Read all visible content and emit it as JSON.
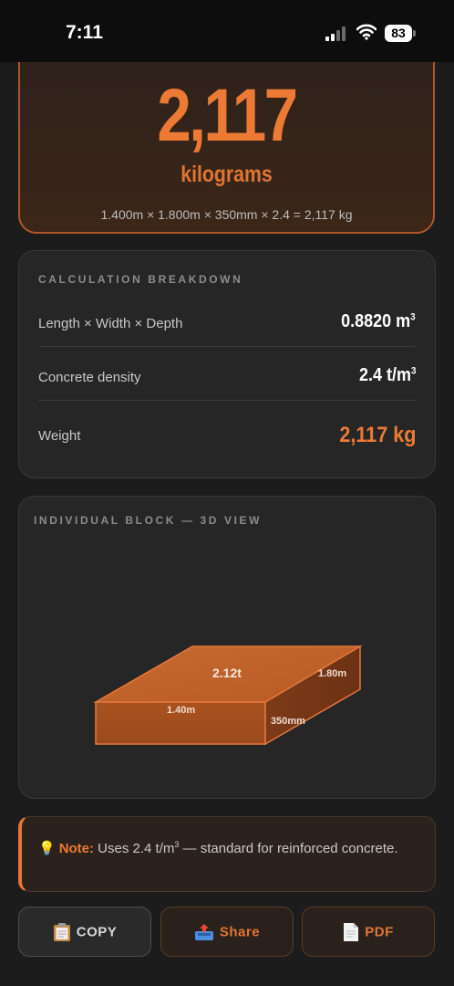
{
  "status": {
    "time": "7:11",
    "battery": "83",
    "icons": [
      "signal-icon",
      "wifi-icon",
      "battery-icon"
    ]
  },
  "result": {
    "value": "2,117",
    "unit": "kilograms",
    "formula": "1.400m × 1.800m × 350mm × 2.4 = 2,117 kg"
  },
  "breakdown": {
    "title": "CALCULATION BREAKDOWN",
    "rows": [
      {
        "label": "Length × Width × Depth",
        "value": "0.8820 m",
        "sup": "3"
      },
      {
        "label": "Concrete density",
        "value": "2.4 t/m",
        "sup": "3"
      },
      {
        "label": "Weight",
        "value": "2,117 kg",
        "sup": ""
      }
    ]
  },
  "block_view": {
    "title": "INDIVIDUAL BLOCK — 3D VIEW",
    "top_label": "2.12t",
    "length_label": "1.40m",
    "width_label": "1.80m",
    "depth_label": "350mm"
  },
  "note": {
    "icon": "lightbulb-icon",
    "strong": "Note:",
    "text_before": " Uses 2.4 t/m",
    "sup": "3",
    "text_after": " — standard for reinforced concrete."
  },
  "actions": {
    "copy": {
      "label": "COPY",
      "icon": "clipboard-icon"
    },
    "share": {
      "label": "Share",
      "icon": "share-icon"
    },
    "pdf": {
      "label": "PDF",
      "icon": "document-icon"
    }
  },
  "colors": {
    "accent": "#ec7a34",
    "background": "#1c1c1c",
    "card": "#262626",
    "block_top": "#c1632a",
    "block_front": "#a95222",
    "block_side": "#7f3c18"
  }
}
